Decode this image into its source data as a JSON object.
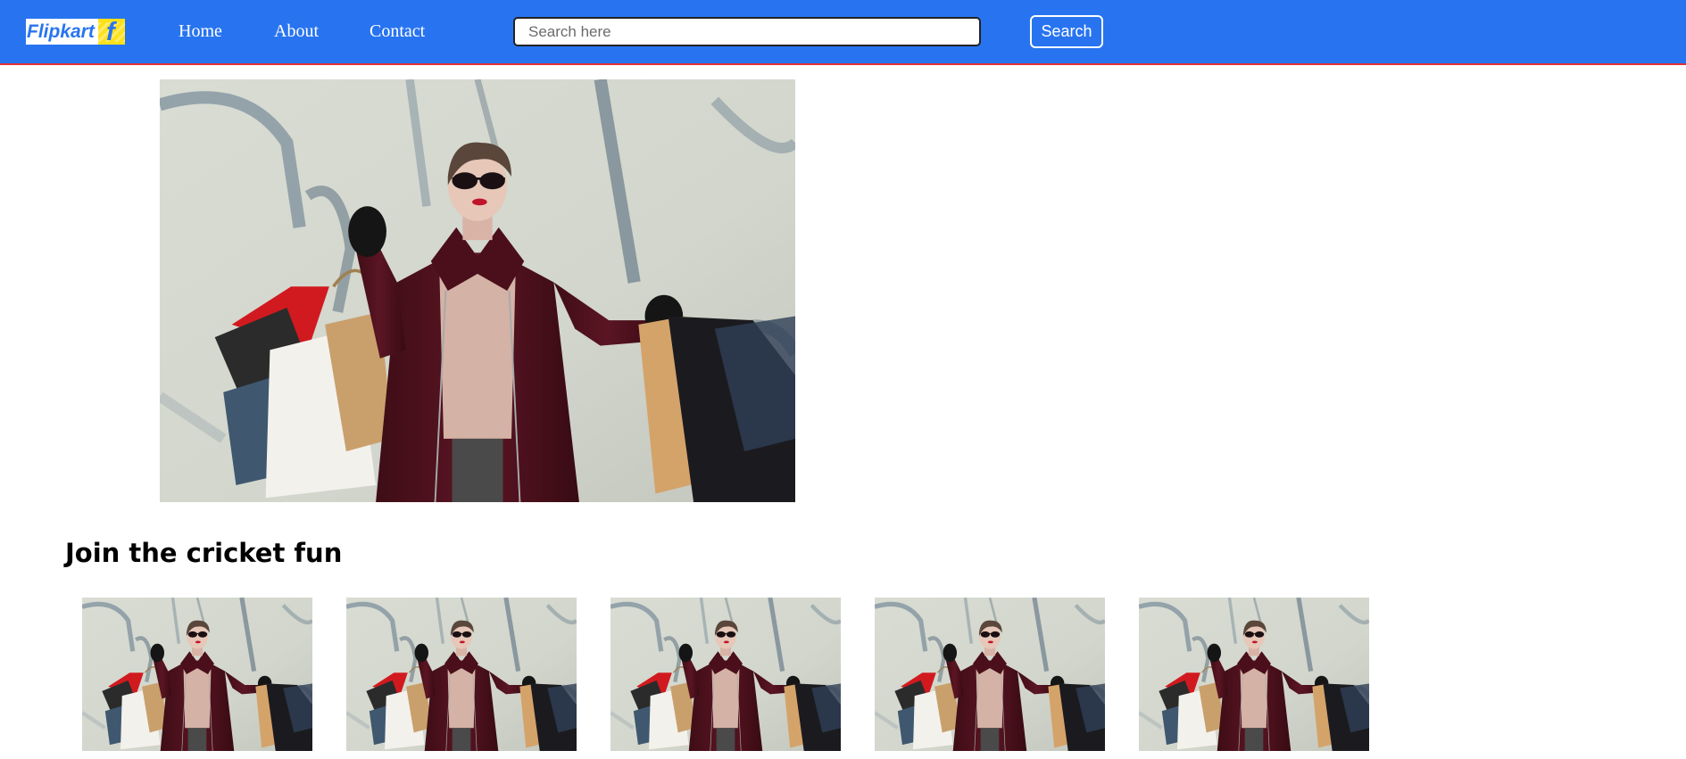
{
  "navbar": {
    "logo_text": "Flipkart",
    "logo_mark": "f",
    "links": [
      "Home",
      "About",
      "Contact"
    ],
    "search": {
      "placeholder": "Search here",
      "value": ""
    },
    "search_button_label": "Search",
    "colors": {
      "background": "#2874f0",
      "border": "#e0303a",
      "logo_yellow": "#ffe11b"
    }
  },
  "hero": {
    "image": "shopping-woman-photo"
  },
  "section": {
    "heading": "Join the cricket fun",
    "thumbnails": [
      "shopping-woman-photo",
      "shopping-woman-photo",
      "shopping-woman-photo",
      "shopping-woman-photo",
      "shopping-woman-photo"
    ]
  }
}
